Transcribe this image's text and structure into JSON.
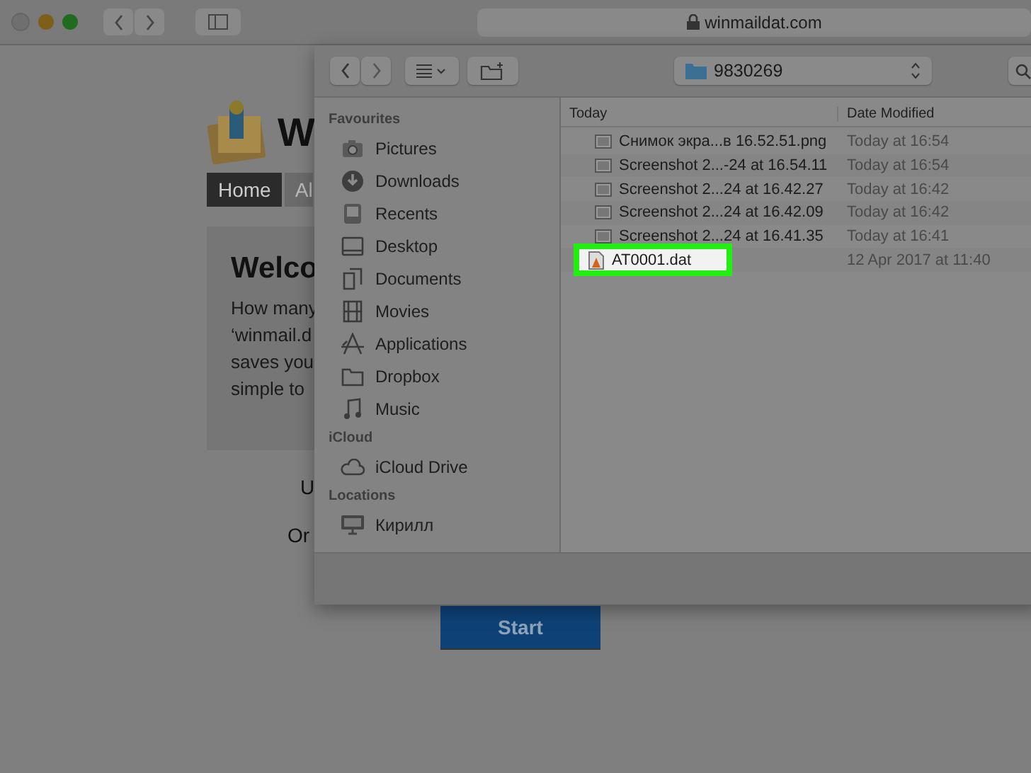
{
  "browser": {
    "address": "winmaildat.com"
  },
  "page": {
    "title": "W",
    "nav": [
      {
        "label": "Home",
        "selected": true
      },
      {
        "label": "Al",
        "selected": false
      }
    ],
    "card": {
      "heading": "Welco",
      "lines": [
        "How many",
        "‘winmail.d",
        "saves you",
        "simple to"
      ]
    },
    "texts": [
      "U",
      "Or"
    ],
    "start_button": "Start"
  },
  "dialog": {
    "folder": "9830269",
    "sidebar": [
      {
        "heading": "Favourites",
        "items": [
          {
            "label": "Pictures"
          },
          {
            "label": "Downloads"
          },
          {
            "label": "Recents"
          },
          {
            "label": "Desktop"
          },
          {
            "label": "Documents"
          },
          {
            "label": "Movies"
          },
          {
            "label": "Applications"
          },
          {
            "label": "Dropbox"
          },
          {
            "label": "Music"
          }
        ]
      },
      {
        "heading": "iCloud",
        "items": [
          {
            "label": "iCloud Drive"
          }
        ]
      },
      {
        "heading": "Locations",
        "items": [
          {
            "label": "Кирилл"
          }
        ]
      }
    ],
    "columns": [
      "Today",
      "Date Modified"
    ],
    "files": [
      {
        "name": "Снимок экра...в 16.52.51.png",
        "date": "Today at 16:54",
        "kind": "image",
        "highlighted": false
      },
      {
        "name": "Screenshot 2...-24 at 16.54.11",
        "date": "Today at 16:54",
        "kind": "image",
        "highlighted": false
      },
      {
        "name": "Screenshot 2...24 at 16.42.27",
        "date": "Today at 16:42",
        "kind": "image",
        "highlighted": false
      },
      {
        "name": "Screenshot 2...24 at 16.42.09",
        "date": "Today at 16:42",
        "kind": "image",
        "highlighted": false
      },
      {
        "name": "Screenshot 2...24 at 16.41.35",
        "date": "Today at 16:41",
        "kind": "image",
        "highlighted": false
      },
      {
        "name": "AT0001.dat",
        "date": "12 Apr 2017 at 11:40",
        "kind": "document",
        "highlighted": true
      }
    ]
  }
}
